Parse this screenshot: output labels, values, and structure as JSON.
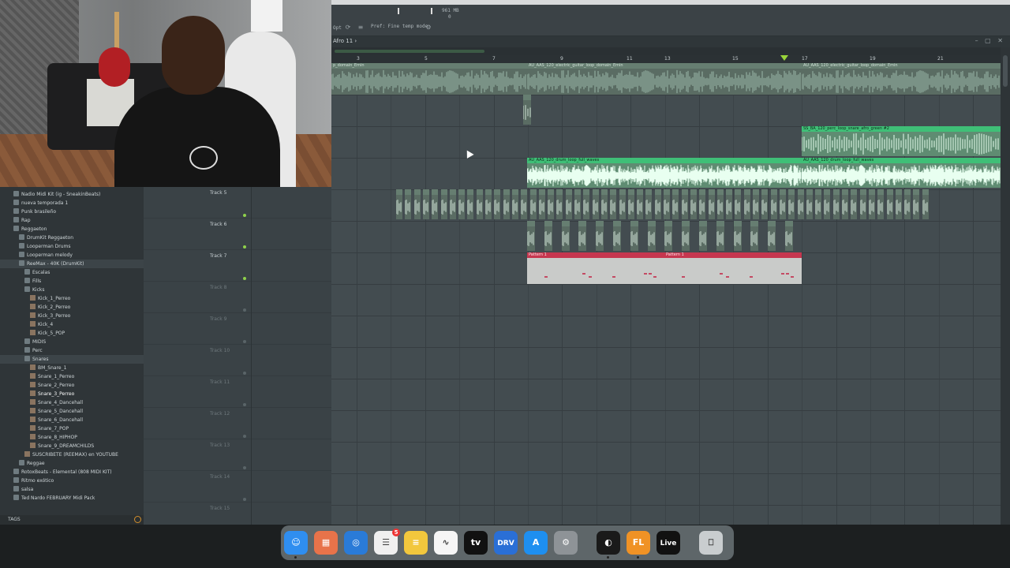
{
  "toolbar": {
    "opt_label": "Opt",
    "memory": "961 MB",
    "cpu_val": "0",
    "hint": "Pref: Fine temp mode"
  },
  "playlist": {
    "title": "Afro 11 ›",
    "ruler": [
      "3",
      "5",
      "7",
      "9",
      "11",
      "13",
      "15",
      "17",
      "19",
      "21"
    ]
  },
  "clips": {
    "guitar_1": "p_domain_Emin",
    "guitar_2": "AU_AAS_120_electric_guitar_loop_domain_Emin",
    "guitar_3": "AU_AAS_120_electric_guitar_loop_domain_Emin",
    "perc": "SS_BA_120_perc_loop_snare_afro_green #2",
    "drum_1": "AU_AAS_120_drum_loop_full_waves",
    "drum_2": "AU_AAS_120_drum_loop_full_waves",
    "pattern_1": "Pattern 1",
    "pattern_2": "Pattern 1"
  },
  "tracks": [
    {
      "name": "Track 5"
    },
    {
      "name": "Track 6"
    },
    {
      "name": "Track 7"
    },
    {
      "name": "Track 8"
    },
    {
      "name": "Track 9"
    },
    {
      "name": "Track 10"
    },
    {
      "name": "Track 11"
    },
    {
      "name": "Track 12"
    },
    {
      "name": "Track 13"
    },
    {
      "name": "Track 14"
    },
    {
      "name": "Track 15"
    }
  ],
  "browser": {
    "items": [
      {
        "label": "Nadio Midi Kit (ig - SneakinBeats)",
        "type": "folder",
        "indent": 1
      },
      {
        "label": "nueva temporada 1",
        "type": "folder",
        "indent": 1
      },
      {
        "label": "Punk brasileño",
        "type": "folder",
        "indent": 1
      },
      {
        "label": "Rap",
        "type": "folder",
        "indent": 1
      },
      {
        "label": "Reggaeton",
        "type": "folder",
        "indent": 1
      },
      {
        "label": "DrumKit Reggaeton",
        "type": "folder",
        "indent": 2
      },
      {
        "label": "Looperman Drums",
        "type": "folder",
        "indent": 2
      },
      {
        "label": "Looperman melody",
        "type": "folder",
        "indent": 2
      },
      {
        "label": "ReeMax - 40K (DrumKit)",
        "type": "folder",
        "indent": 2,
        "selected": true
      },
      {
        "label": "Escalas",
        "type": "folder",
        "indent": 3
      },
      {
        "label": "Fills",
        "type": "folder",
        "indent": 3
      },
      {
        "label": "Kicks",
        "type": "folder",
        "indent": 3
      },
      {
        "label": "Kick_1_Perreo",
        "type": "file",
        "indent": 4
      },
      {
        "label": "Kick_2_Perreo",
        "type": "file",
        "indent": 4
      },
      {
        "label": "Kick_3_Perreo",
        "type": "file",
        "indent": 4
      },
      {
        "label": "Kick_4",
        "type": "file",
        "indent": 4
      },
      {
        "label": "Kick_5_POP",
        "type": "file",
        "indent": 4
      },
      {
        "label": "MIDIS",
        "type": "folder",
        "indent": 3
      },
      {
        "label": "Perc",
        "type": "folder",
        "indent": 3
      },
      {
        "label": "Snares",
        "type": "folder",
        "indent": 3,
        "selected": true
      },
      {
        "label": "BM_Snare_1",
        "type": "file",
        "indent": 4
      },
      {
        "label": "Snare_1_Perreo",
        "type": "file",
        "indent": 4
      },
      {
        "label": "Snare_2_Perreo",
        "type": "file",
        "indent": 4
      },
      {
        "label": "Snare_3_Perreo",
        "type": "file",
        "indent": 4,
        "highlight": true
      },
      {
        "label": "Snare_4_Dancehall",
        "type": "file",
        "indent": 4
      },
      {
        "label": "Snare_5_Dancehall",
        "type": "file",
        "indent": 4
      },
      {
        "label": "Snare_6_Dancehall",
        "type": "file",
        "indent": 4
      },
      {
        "label": "Snare_7_POP",
        "type": "file",
        "indent": 4
      },
      {
        "label": "Snare_8_HIPHOP",
        "type": "file",
        "indent": 4
      },
      {
        "label": "Snare_9_DREAMCHILDS",
        "type": "file",
        "indent": 4
      },
      {
        "label": "SUSCRIBETE (REEMAX) en YOUTUBE",
        "type": "file",
        "indent": 3
      },
      {
        "label": "Reggae",
        "type": "folder",
        "indent": 2
      },
      {
        "label": "RotoxBeats - Elemental (808 MIDI KIT)",
        "type": "folder",
        "indent": 1
      },
      {
        "label": "Ritmo exótico",
        "type": "folder",
        "indent": 1
      },
      {
        "label": "salsa",
        "type": "folder",
        "indent": 1
      },
      {
        "label": "Ted Nardo FEBRUARY Midi Pack",
        "type": "folder",
        "indent": 1
      }
    ]
  },
  "search": {
    "label": "TAGS"
  },
  "dock": {
    "apps": [
      {
        "name": "finder-icon",
        "label": "☺",
        "color": "#2f8ef0"
      },
      {
        "name": "launchpad-icon",
        "label": "▦",
        "color": "#e8734a"
      },
      {
        "name": "safari-icon",
        "label": "◎",
        "color": "#2a7bd8"
      },
      {
        "name": "reminders-icon",
        "label": "☰",
        "color": "#f0f0f0",
        "badge": "5"
      },
      {
        "name": "notes-icon",
        "label": "≡",
        "color": "#f2c73d"
      },
      {
        "name": "freeform-icon",
        "label": "∿",
        "color": "#f6f6f6"
      },
      {
        "name": "appletv-icon",
        "label": "tv",
        "color": "#111111"
      },
      {
        "name": "cleaner-icon",
        "label": "DRV",
        "color": "#2a6fd6"
      },
      {
        "name": "appstore-icon",
        "label": "A",
        "color": "#1e8ff0"
      },
      {
        "name": "settings-icon",
        "label": "⚙",
        "color": "#8e9397"
      },
      {
        "name": "activity-icon",
        "label": "◐",
        "color": "#1a1a1a"
      },
      {
        "name": "flstudio-icon",
        "label": "FL",
        "color": "#f09225"
      },
      {
        "name": "ableton-icon",
        "label": "Live",
        "color": "#111111"
      },
      {
        "name": "trash-icon",
        "label": "⎕",
        "color": "#c9cdcf"
      }
    ]
  },
  "colors": {
    "clip_green": "#3fbf77",
    "pattern_red": "#c6364f",
    "accent_orange": "#f09225"
  }
}
